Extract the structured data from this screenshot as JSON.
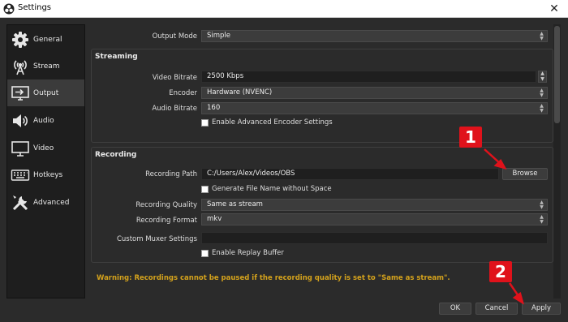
{
  "window": {
    "title": "Settings",
    "close_glyph": "✕"
  },
  "sidebar": {
    "items": [
      {
        "label": "General",
        "icon": "gear-icon"
      },
      {
        "label": "Stream",
        "icon": "broadcast-tower-icon"
      },
      {
        "label": "Output",
        "icon": "monitor-output-icon",
        "active": true
      },
      {
        "label": "Audio",
        "icon": "speaker-icon"
      },
      {
        "label": "Video",
        "icon": "display-icon"
      },
      {
        "label": "Hotkeys",
        "icon": "keyboard-icon"
      },
      {
        "label": "Advanced",
        "icon": "tools-icon"
      }
    ]
  },
  "output_mode": {
    "label": "Output Mode",
    "value": "Simple"
  },
  "streaming": {
    "title": "Streaming",
    "video_bitrate": {
      "label": "Video Bitrate",
      "value": "2500 Kbps"
    },
    "encoder": {
      "label": "Encoder",
      "value": "Hardware (NVENC)"
    },
    "audio_bitrate": {
      "label": "Audio Bitrate",
      "value": "160"
    },
    "advanced_encoder": {
      "label": "Enable Advanced Encoder Settings",
      "checked": false
    }
  },
  "recording": {
    "title": "Recording",
    "path": {
      "label": "Recording Path",
      "value": "C:/Users/Alex/Videos/OBS",
      "browse_label": "Browse"
    },
    "no_space": {
      "label": "Generate File Name without Space",
      "checked": false
    },
    "quality": {
      "label": "Recording Quality",
      "value": "Same as stream"
    },
    "format": {
      "label": "Recording Format",
      "value": "mkv"
    },
    "muxer": {
      "label": "Custom Muxer Settings",
      "value": ""
    },
    "replay_buffer": {
      "label": "Enable Replay Buffer",
      "checked": false
    }
  },
  "warning": "Warning: Recordings cannot be paused if the recording quality is set to \"Same as stream\".",
  "footer": {
    "ok_label": "OK",
    "cancel_label": "Cancel",
    "apply_label": "Apply"
  },
  "annotations": {
    "badge_1": "1",
    "badge_2": "2",
    "color": "#e0121b"
  },
  "colors": {
    "warning": "#d4a21c",
    "background": "#2b2b2b",
    "sidebar_bg": "#1e1e1e"
  }
}
